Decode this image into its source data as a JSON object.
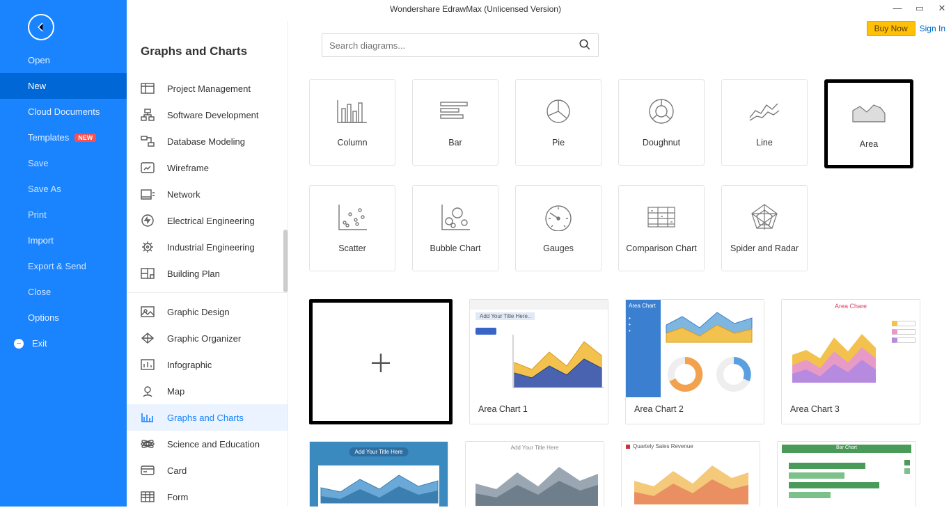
{
  "window": {
    "title": "Wondershare EdrawMax (Unlicensed Version)",
    "buy_now": "Buy Now",
    "sign_in": "Sign In",
    "ctrls": {
      "min": "—",
      "max": "▭",
      "close": "✕"
    }
  },
  "bluenav": {
    "items": [
      {
        "label": "Open"
      },
      {
        "label": "New",
        "active": true
      },
      {
        "label": "Cloud Documents"
      },
      {
        "label": "Templates",
        "badge": "NEW"
      },
      {
        "label": "Save",
        "dim": true
      },
      {
        "label": "Save As",
        "dim": true
      },
      {
        "label": "Print",
        "dim": true
      },
      {
        "label": "Import"
      },
      {
        "label": "Export & Send",
        "dim": true
      },
      {
        "label": "Close",
        "dim": true
      },
      {
        "label": "Options"
      },
      {
        "label": "Exit",
        "exit": true
      }
    ]
  },
  "catbar": {
    "header": "Graphs and Charts",
    "groups": [
      [
        "Project Management",
        "Software Development",
        "Database Modeling",
        "Wireframe",
        "Network",
        "Electrical Engineering",
        "Industrial Engineering",
        "Building Plan"
      ],
      [
        "Graphic Design",
        "Graphic Organizer",
        "Infographic",
        "Map",
        "Graphs and Charts",
        "Science and Education",
        "Card",
        "Form"
      ]
    ],
    "selected": "Graphs and Charts"
  },
  "search": {
    "placeholder": "Search diagrams..."
  },
  "tiles": [
    {
      "label": "Column",
      "icon": "column"
    },
    {
      "label": "Bar",
      "icon": "bar"
    },
    {
      "label": "Pie",
      "icon": "pie"
    },
    {
      "label": "Doughnut",
      "icon": "doughnut"
    },
    {
      "label": "Line",
      "icon": "line"
    },
    {
      "label": "Area",
      "icon": "area",
      "selected": true
    },
    {
      "label": "Scatter",
      "icon": "scatter"
    },
    {
      "label": "Bubble Chart",
      "icon": "bubble"
    },
    {
      "label": "Gauges",
      "icon": "gauge"
    },
    {
      "label": "Comparison Chart",
      "icon": "compare"
    },
    {
      "label": "Spider and Radar",
      "icon": "radar"
    }
  ],
  "templates": [
    {
      "name": "",
      "blank": true
    },
    {
      "name": "Area Chart 1",
      "thumb": "th1",
      "title_text": "Add Your Title Here.."
    },
    {
      "name": "Area Chart 2",
      "thumb": "th2",
      "title_text": "Area Chart"
    },
    {
      "name": "Area Chart 3",
      "thumb": "th3",
      "title_text": "Area Chare"
    }
  ],
  "templates_row2": [
    {
      "thumb": "th4",
      "title_text": "Add Your Title Here"
    },
    {
      "thumb": "th5",
      "title_text": "Add Your Title Here"
    },
    {
      "thumb": "th6",
      "title_text": "Quartely Sales Revenue"
    },
    {
      "thumb": "th7",
      "title_text": "Bar Chart"
    }
  ]
}
